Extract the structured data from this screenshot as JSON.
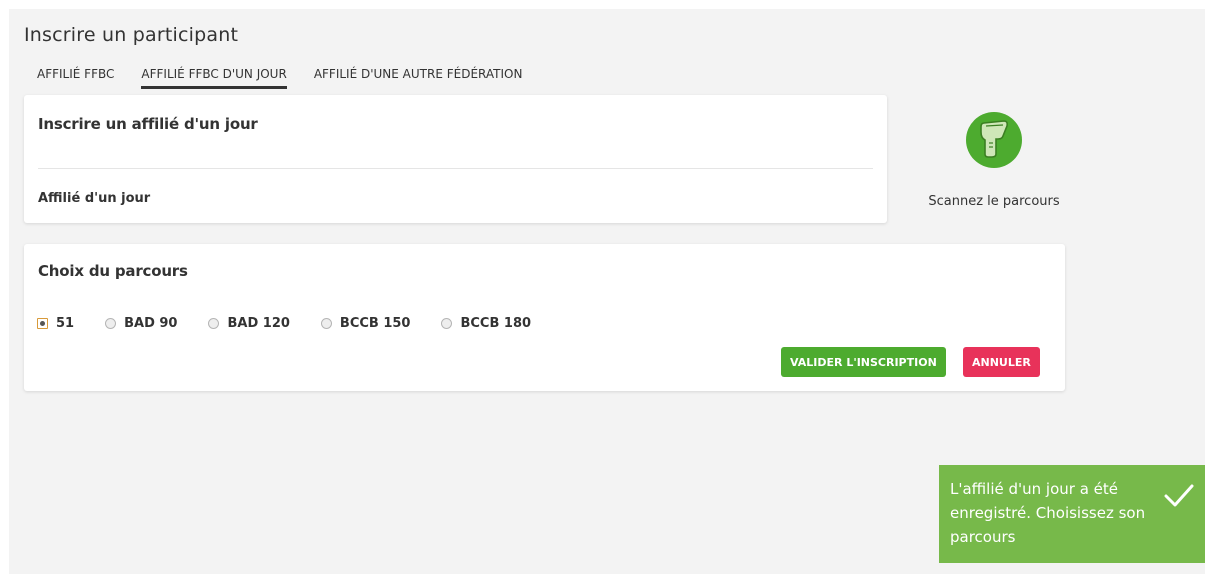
{
  "page": {
    "title": "Inscrire un participant"
  },
  "tabs": [
    {
      "label": "AFFILIÉ FFBC",
      "active": false
    },
    {
      "label": "AFFILIÉ FFBC D'UN JOUR",
      "active": true
    },
    {
      "label": "AFFILIÉ D'UNE AUTRE FÉDÉRATION",
      "active": false
    }
  ],
  "affilie_card": {
    "title": "Inscrire un affilié d'un jour",
    "field_label": "Affilié d'un jour"
  },
  "scanner": {
    "label": "Scannez le parcours",
    "icon": "barcode-scanner-icon"
  },
  "parcours_card": {
    "title": "Choix du parcours",
    "options": [
      {
        "label": "51",
        "checked": true
      },
      {
        "label": "BAD 90",
        "checked": false
      },
      {
        "label": "BAD 120",
        "checked": false
      },
      {
        "label": "BCCB 150",
        "checked": false
      },
      {
        "label": "BCCB 180",
        "checked": false
      }
    ],
    "submit_label": "VALIDER L'INSCRIPTION",
    "cancel_label": "ANNULER"
  },
  "toast": {
    "message": "L'affilié d'un jour a été enregistré. Choisissez son parcours",
    "icon": "checkmark-icon"
  },
  "colors": {
    "accent_green": "#4dab2f",
    "danger_red": "#e8325a",
    "toast_green": "#77b94a",
    "background": "#f3f3f3"
  }
}
